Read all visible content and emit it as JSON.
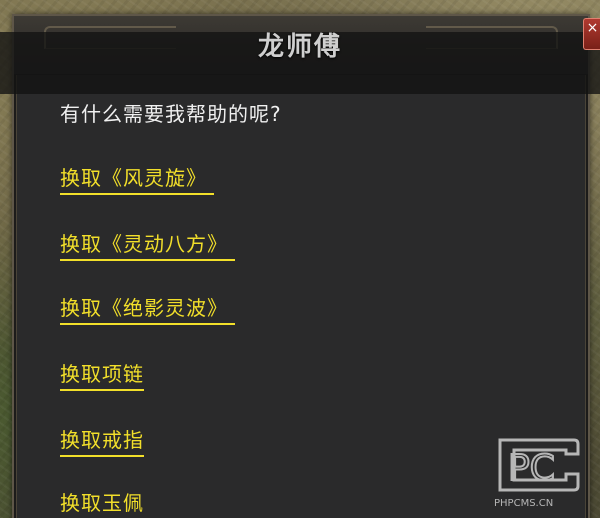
{
  "dialog": {
    "title": "龙师傅",
    "close_label": "×",
    "greeting": "有什么需要我帮助的呢?",
    "options": [
      {
        "label": "换取《风灵旋》 "
      },
      {
        "label": "换取《灵动八方》 "
      },
      {
        "label": "换取《绝影灵波》 "
      },
      {
        "label": "换取项链"
      },
      {
        "label": "换取戒指"
      },
      {
        "label": "换取玉佩"
      }
    ]
  },
  "watermark": {
    "logo_letters": "PC",
    "site": "PHPCMS.CN"
  },
  "colors": {
    "option_link": "#f2df2a",
    "dialog_bg": "#2a2a2b",
    "greeting_text": "#f0f0f0",
    "title_text": "#cfcfcf",
    "close_button": "#b03a30"
  },
  "icons": {
    "close": "close-icon"
  }
}
